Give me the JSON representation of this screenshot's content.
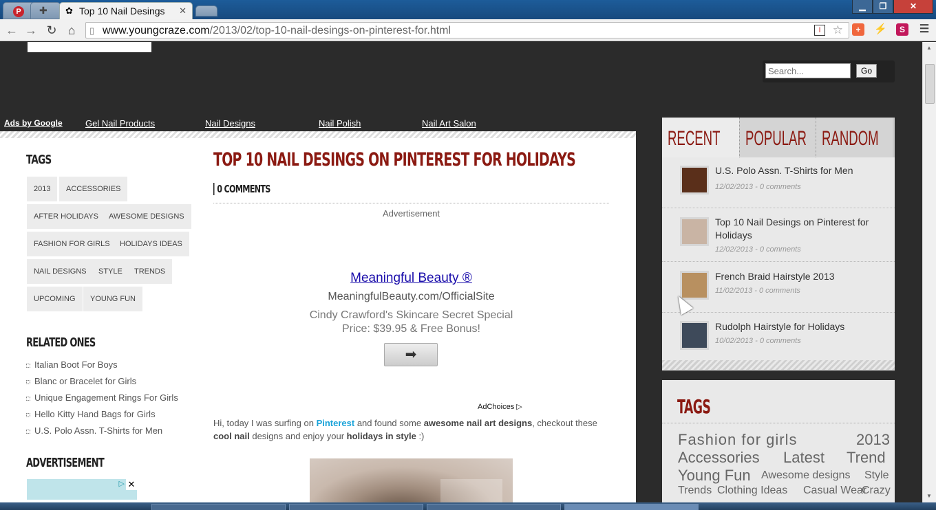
{
  "browser": {
    "tab_title": "Top 10 Nail Desings",
    "url_host": "www.youngcraze.com",
    "url_path": "/2013/02/top-10-nail-desings-on-pinterest-for.html"
  },
  "search": {
    "placeholder": "Search...",
    "go": "Go"
  },
  "ads_bar": {
    "label": "Ads by Google",
    "links": [
      "Gel Nail Products",
      "Nail Designs",
      "Nail Polish",
      "Nail Art Salon"
    ]
  },
  "left": {
    "tags_heading": "TAGS",
    "tags": [
      "2013",
      "ACCESSORIES",
      "AFTER HOLIDAYS",
      "AWESOME DESIGNS",
      "FASHION FOR GIRLS",
      "HOLIDAYS IDEAS",
      "NAIL DESIGNS",
      "STYLE",
      "TRENDS",
      "UPCOMING",
      "YOUNG FUN"
    ],
    "related_heading": "RELATED ONES",
    "related": [
      "Italian Boot For Boys",
      "Blanc or Bracelet for Girls",
      "Unique Engagement Rings For Girls",
      "Hello Kitty Hand Bags for Girls",
      "U.S. Polo Assn. T-Shirts for Men"
    ],
    "ad_heading": "ADVERTISEMENT"
  },
  "post": {
    "title": "TOP 10 NAIL DESINGS ON PINTEREST FOR HOLIDAYS",
    "comments": "0 COMMENTS",
    "ad_label": "Advertisement",
    "ad": {
      "title": "Meaningful Beauty ®",
      "url": "MeaningfulBeauty.com/OfficialSite",
      "line1": "Cindy Crawford's Skincare Secret Special",
      "line2": "Price: $39.95 & Free Bonus!",
      "choices": "AdChoices"
    },
    "intro": {
      "a": "Hi, today I was surfing on ",
      "pin": "Pinterest",
      "b": " and found some ",
      "c": "awesome nail art designs",
      "d": ", checkout these ",
      "e": "cool nail",
      "f": " designs and enjoy your ",
      "g": "holidays in style",
      "h": " :)"
    }
  },
  "sidebar": {
    "tabs": [
      "RECENT",
      "POPULAR",
      "RANDOM"
    ],
    "recent": [
      {
        "title": "U.S. Polo Assn. T-Shirts for Men",
        "meta": "12/02/2013 - 0 comments"
      },
      {
        "title": "Top 10 Nail Desings on Pinterest for Holidays",
        "meta": "12/02/2013 - 0 comments"
      },
      {
        "title": "French Braid Hairstyle 2013",
        "meta": "11/02/2013 - 0 comments"
      },
      {
        "title": "Rudolph Hairstyle for Holidays",
        "meta": "10/02/2013 - 0 comments"
      }
    ],
    "cloud_heading": "TAGS",
    "cloud": [
      "Fashion for girls",
      "2013",
      "Accessories",
      "Latest",
      "Trend",
      "Young Fun",
      "Awesome designs",
      "Style",
      "Trends",
      "Clothing Ideas",
      "Casual Wear",
      "Crazy"
    ]
  },
  "colors": {
    "accent": "#8b1a12",
    "link": "#1a0dab",
    "pinterest": "#1aa3d9"
  }
}
